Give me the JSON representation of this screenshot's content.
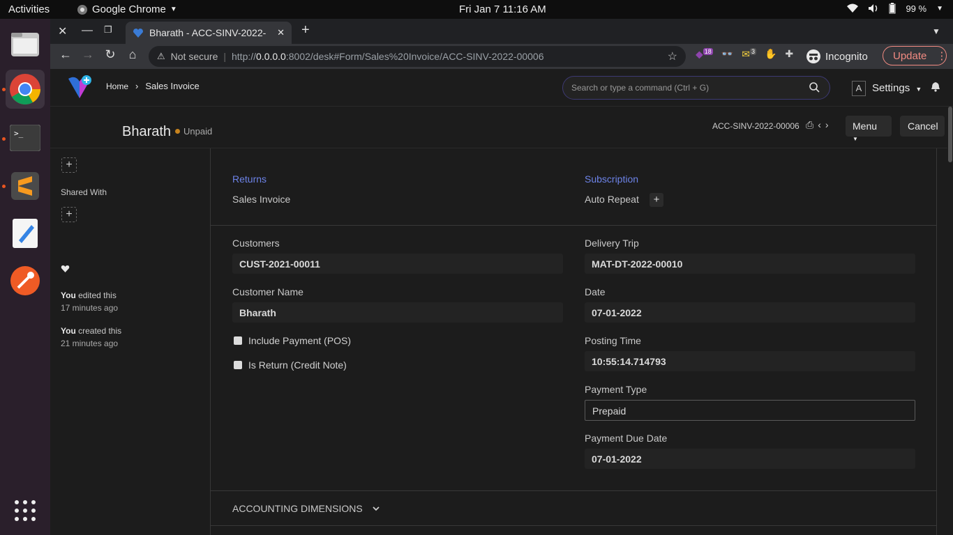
{
  "topbar": {
    "activities": "Activities",
    "app": "Google Chrome",
    "clock": "Fri Jan 7  11:16 AM",
    "battery": "99 %"
  },
  "browser": {
    "tab_title": "Bharath - ACC-SINV-2022-",
    "not_secure": "Not secure",
    "url_host": "0.0.0.0",
    "url_pre": "http://",
    "url_rest": ":8002/desk#Form/Sales%20Invoice/ACC-SINV-2022-00006",
    "incognito": "Incognito",
    "update": "Update",
    "ext_badge_1": "18",
    "ext_badge_2": "3"
  },
  "navbar": {
    "home": "Home",
    "sales_invoice": "Sales Invoice",
    "search_placeholder": "Search or type a command (Ctrl + G)",
    "avatar_letter": "A",
    "settings": "Settings"
  },
  "page": {
    "title": "Bharath",
    "status": "Unpaid",
    "docname": "ACC-SINV-2022-00006",
    "menu": "Menu",
    "cancel": "Cancel"
  },
  "sidebar": {
    "shared_with": "Shared With",
    "activity": [
      {
        "who": "You",
        "action": " edited this",
        "when": "17 minutes ago"
      },
      {
        "who": "You",
        "action": " created this",
        "when": "21 minutes ago"
      }
    ]
  },
  "form": {
    "returns": "Returns",
    "returns_item": "Sales Invoice",
    "subscription": "Subscription",
    "subscription_item": "Auto Repeat",
    "customers_label": "Customers",
    "customers_value": "CUST-2021-00011",
    "customer_name_label": "Customer Name",
    "customer_name_value": "Bharath",
    "include_payment": "Include Payment (POS)",
    "is_return": "Is Return (Credit Note)",
    "delivery_trip_label": "Delivery Trip",
    "delivery_trip_value": "MAT-DT-2022-00010",
    "date_label": "Date",
    "date_value": "07-01-2022",
    "posting_time_label": "Posting Time",
    "posting_time_value": "10:55:14.714793",
    "payment_type_label": "Payment Type",
    "payment_type_value": "Prepaid",
    "payment_due_label": "Payment Due Date",
    "payment_due_value": "07-01-2022",
    "accounting_dimensions": "ACCOUNTING DIMENSIONS"
  }
}
